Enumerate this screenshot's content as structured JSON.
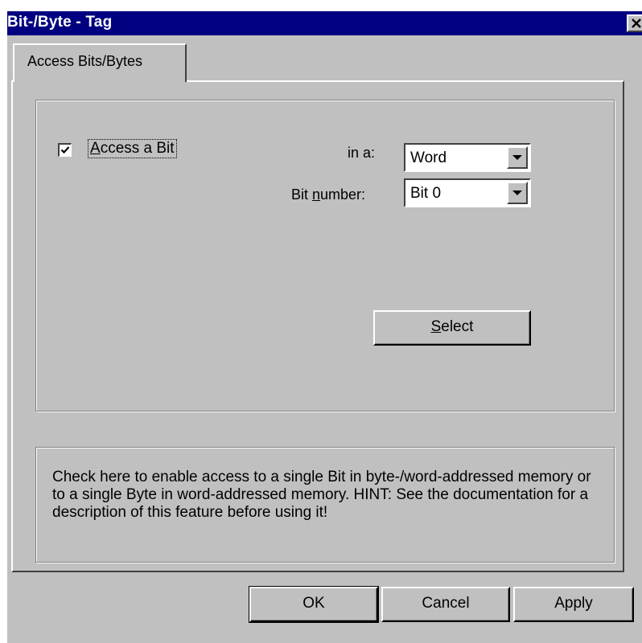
{
  "window": {
    "title": "Bit-/Byte - Tag"
  },
  "tabs": [
    {
      "label": "Access Bits/Bytes",
      "active": true
    }
  ],
  "access_bit": {
    "checked": true,
    "label_pre": "Access a",
    "label_mnemonic": "",
    "label_post": " Bit"
  },
  "in_a": {
    "label": "in a:",
    "value": "Word"
  },
  "bit_number": {
    "label_pre": "Bit ",
    "label_mnemonic": "n",
    "label_post": "umber:",
    "value": "Bit 0"
  },
  "select_button": {
    "mnemonic": "S",
    "rest": "elect"
  },
  "hint": {
    "text": "Check here to enable access to a single Bit in byte-/word-addressed memory or to a single Byte in word-addressed memory. HINT: See the documentation for a description of this feature before using it!"
  },
  "footer": {
    "ok_label": "OK",
    "cancel_label": "Cancel",
    "apply_label": "Apply"
  },
  "colors": {
    "title_bar": "#000080",
    "face": "#c0c0c0"
  },
  "icons": {
    "close": "close-icon",
    "check": "checkmark-icon",
    "dropdown": "chevron-down-icon"
  }
}
